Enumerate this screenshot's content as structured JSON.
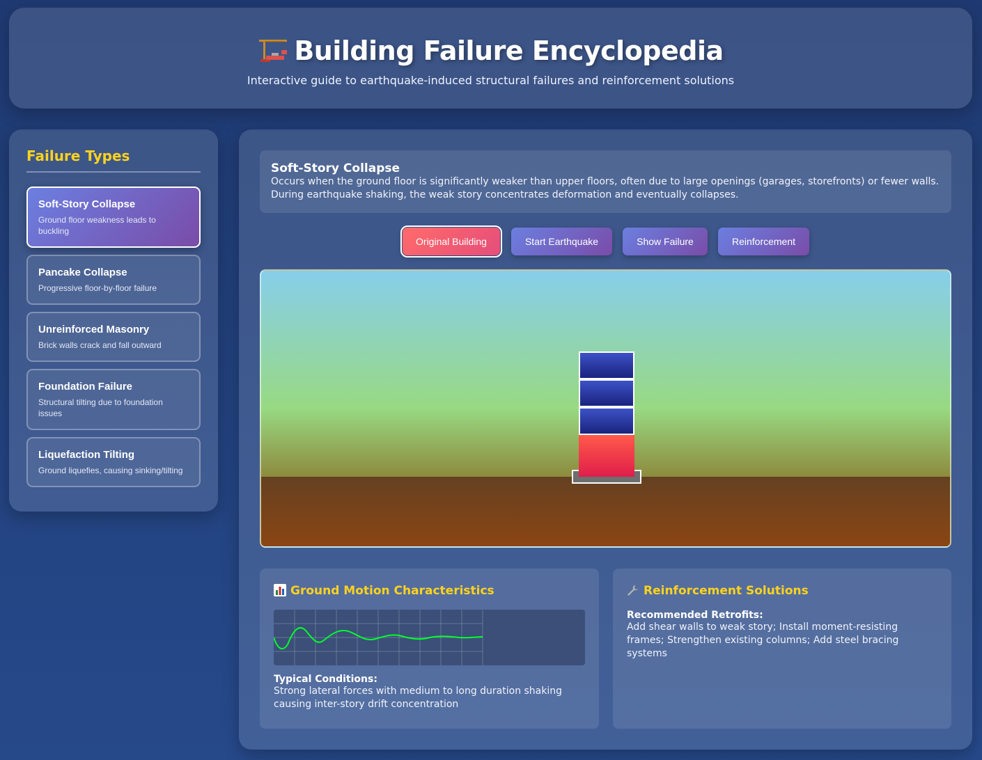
{
  "header": {
    "title": "Building Failure Encyclopedia",
    "subtitle": "Interactive guide to earthquake-induced structural failures and reinforcement solutions",
    "title_icon": "construction-crane-icon"
  },
  "sidebar": {
    "heading": "Failure Types",
    "items": [
      {
        "title": "Soft-Story Collapse",
        "desc": "Ground floor weakness leads to buckling",
        "active": true
      },
      {
        "title": "Pancake Collapse",
        "desc": "Progressive floor-by-floor failure",
        "active": false
      },
      {
        "title": "Unreinforced Masonry",
        "desc": "Brick walls crack and fall outward",
        "active": false
      },
      {
        "title": "Foundation Failure",
        "desc": "Structural tilting due to foundation issues",
        "active": false
      },
      {
        "title": "Liquefaction Tilting",
        "desc": "Ground liquefies, causing sinking/tilting",
        "active": false
      }
    ]
  },
  "main": {
    "info": {
      "title": "Soft-Story Collapse",
      "description": "Occurs when the ground floor is significantly weaker than upper floors, often due to large openings (garages, storefronts) or fewer walls. During earthquake shaking, the weak story concentrates deformation and eventually collapses."
    },
    "controls": [
      {
        "label": "Original Building",
        "active": true
      },
      {
        "label": "Start Earthquake",
        "active": false
      },
      {
        "label": "Show Failure",
        "active": false
      },
      {
        "label": "Reinforcement",
        "active": false
      }
    ],
    "ground_motion": {
      "heading": "Ground Motion Characteristics",
      "icon": "bar-chart-icon",
      "conditions_label": "Typical Conditions:",
      "conditions_text": "Strong lateral forces with medium to long duration shaking causing inter-story drift concentration"
    },
    "reinforcement": {
      "heading": "Reinforcement Solutions",
      "icon": "wrench-icon",
      "retrofits_label": "Recommended Retrofits:",
      "retrofits_text": "Add shear walls to weak story; Install moment-resisting frames; Strengthen existing columns; Add steel bracing systems"
    }
  },
  "colors": {
    "accent_yellow": "#ffd21f",
    "button_gradient_start": "#6b7fe0",
    "button_gradient_end": "#7a4ca8",
    "active_button": "#ff6b6b",
    "soft_story_red": "#e01e4a",
    "wave_green": "#00ff2a"
  }
}
